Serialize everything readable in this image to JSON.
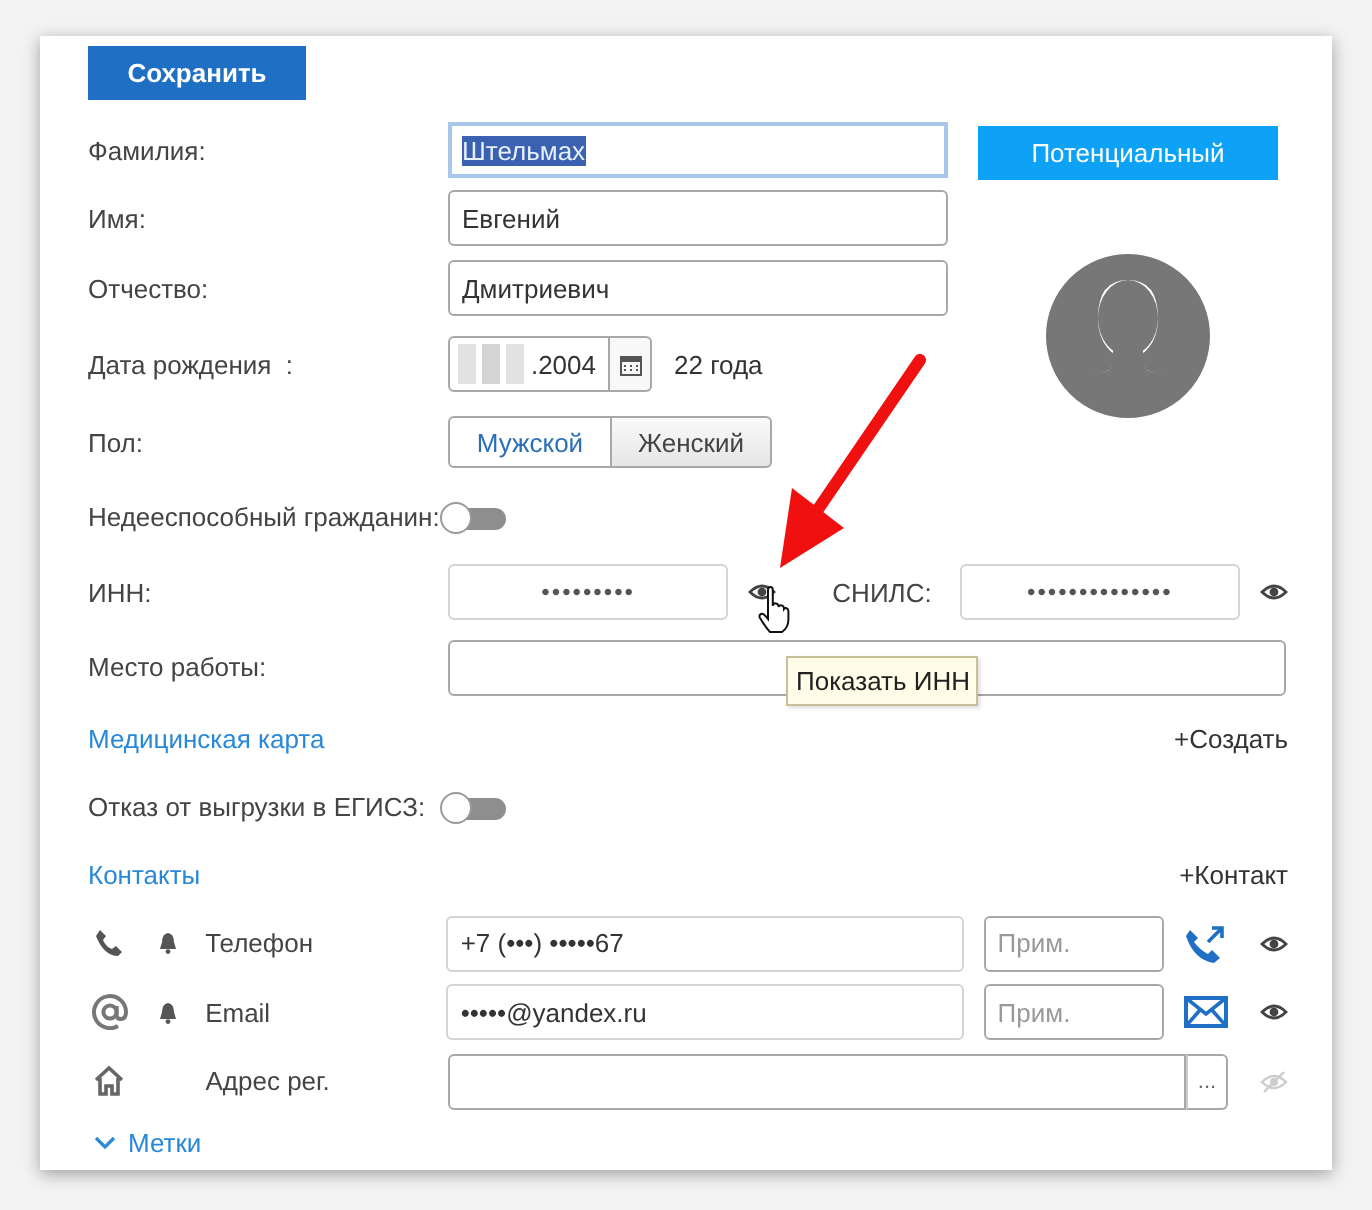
{
  "save_button": "Сохранить",
  "status_button": "Потенциальный",
  "fields": [
    {
      "label": "Фамилия:",
      "value": "Штельмах",
      "focused": true,
      "text_selected": true
    },
    {
      "label": "Имя:",
      "value": "Евгений",
      "focused": false,
      "text_selected": false
    },
    {
      "label": "Отчество:",
      "value": "Дмитриевич",
      "focused": false,
      "text_selected": false
    }
  ],
  "birth_date": {
    "label": "Дата рождения  :",
    "value": ".2004",
    "redacted": true,
    "age": "22 года"
  },
  "gender": {
    "label": "Пол:",
    "options": [
      {
        "label": "Мужской",
        "selected": true
      },
      {
        "label": "Женский",
        "selected": false
      }
    ]
  },
  "incapable": {
    "label": "Недееспособный гражданин:",
    "on": false
  },
  "inn": {
    "label": "ИНН:",
    "value": "•••••••••",
    "tooltip": "Показать ИНН"
  },
  "snils": {
    "label": "СНИЛС:",
    "value": "••••••••••••••"
  },
  "workplace": {
    "label": "Место работы:"
  },
  "medical_card": {
    "title": "Медицинская карта",
    "action": "+Создать"
  },
  "egisz_refusal": {
    "label": "Отказ от выгрузки в ЕГИСЗ:",
    "on": false
  },
  "contacts": {
    "title": "Контакты",
    "action": "+Контакт",
    "items": [
      {
        "kind": "phone",
        "notify": true,
        "label": "Телефон",
        "value": "+7 (•••) •••••67",
        "note_placeholder": "Прим.",
        "hidden": false
      },
      {
        "kind": "email",
        "notify": true,
        "label": "Email",
        "value": "•••••@yandex.ru",
        "note_placeholder": "Прим.",
        "hidden": false
      },
      {
        "kind": "address",
        "notify": false,
        "label": "Адрес рег.",
        "action": "...",
        "hidden": true
      }
    ]
  },
  "tags": {
    "title": "Метки"
  }
}
